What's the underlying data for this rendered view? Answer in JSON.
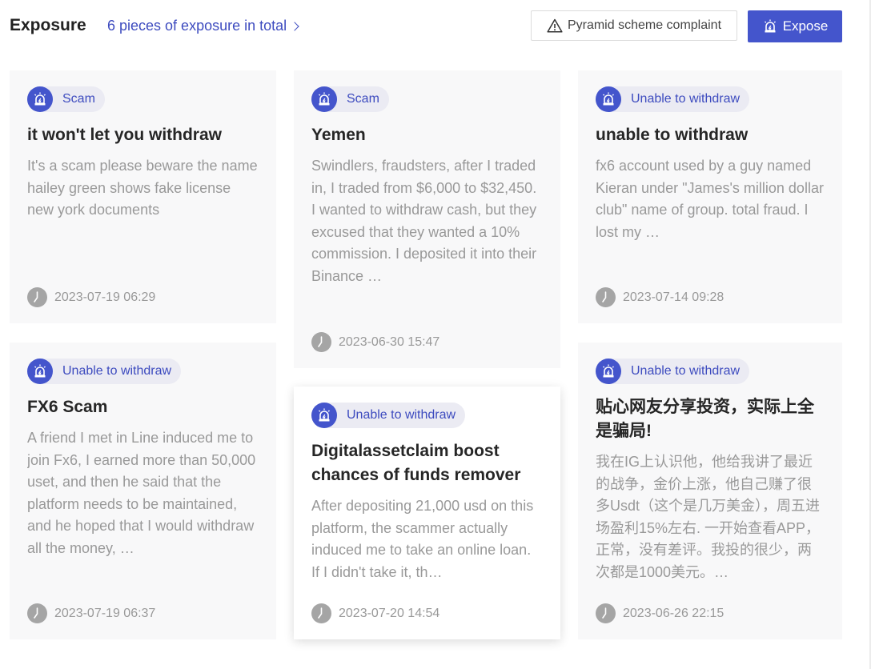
{
  "header": {
    "title": "Exposure",
    "total_link": "6 pieces of exposure in total",
    "complaint_button": "Pyramid scheme complaint",
    "expose_button": "Expose"
  },
  "colors": {
    "accent": "#4455cc",
    "tag_bg": "#ebebf3",
    "card_bg": "#f8f8f9",
    "muted_text": "#999999"
  },
  "cards": [
    {
      "tag": "Scam",
      "title": "it won't let you withdraw",
      "description": "It's a scam please beware the name hailey green shows fake license new york documents",
      "time": "2023-07-19 06:29"
    },
    {
      "tag": "Scam",
      "title": "Yemen",
      "description": "Swindlers, fraudsters, after I traded in, I traded from $6,000 to $32,450. I wanted to withdraw cash, but they excused that they wanted a 10% commission. I deposited it into their Binance …",
      "time": "2023-06-30 15:47"
    },
    {
      "tag": "Unable to withdraw",
      "title": "unable to withdraw",
      "description": "fx6 account used by a guy named Kieran under \"James's million dollar club\" name of group. total fraud. I lost my …",
      "time": "2023-07-14 09:28"
    },
    {
      "tag": "Unable to withdraw",
      "title": "FX6 Scam",
      "description": "A friend I met in Line induced me to join Fx6, I earned more than 50,000 uset, and then he said that the platform needs to be maintained, and he hoped that I would withdraw all the money, …",
      "time": "2023-07-19 06:37"
    },
    {
      "tag": "Unable to withdraw",
      "title": "Digitalassetclaim boost chances of funds remover",
      "description": "After depositing 21,000 usd on this platform, the scammer actually induced me to take an online loan. If I didn't take it, th…",
      "time": "2023-07-20 14:54"
    },
    {
      "tag": "Unable to withdraw",
      "title": "贴心网友分享投资，实际上全是骗局!",
      "description": "我在IG上认识他，他给我讲了最近的战争，金价上涨，他自己赚了很多Usdt（这个是几万美金），周五进场盈利15%左右. 一开始查看APP，正常，没有差评。我投的很少，两次都是1000美元。…",
      "time": "2023-06-26 22:15"
    }
  ]
}
